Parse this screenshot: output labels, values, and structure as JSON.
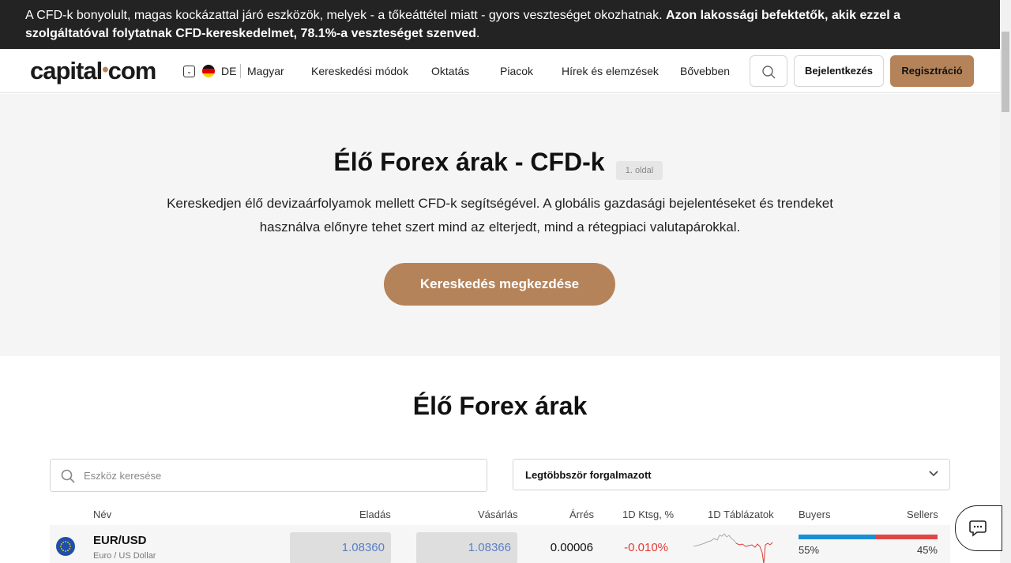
{
  "risk_warning": {
    "text": "A CFD-k bonyolult, magas kockázattal járó eszközök, melyek - a tőkeáttétel miatt - gyors veszteséget okozhatnak. ",
    "bold": "Azon lakossági befektetők, akik ezzel a szolgáltatóval folytatnak CFD-kereskedelmet, 78.1%-a veszteséget szenved",
    "end": "."
  },
  "header": {
    "logo_left": "capital",
    "logo_dot": "•",
    "logo_right": "com",
    "lang_code": "DE",
    "lang_name": "Magyar",
    "nav": [
      "Kereskedési módok",
      "Oktatás",
      "Piacok",
      "Hírek és elemzések",
      "Bővebben"
    ],
    "login": "Bejelentkezés",
    "register": "Regisztráció"
  },
  "hero": {
    "title": "Élő Forex árak - CFD-k",
    "badge": "1. oldal",
    "description": "Kereskedjen élő devizaárfolyamok mellett CFD-k segítségével. A globális gazdasági bejelentéseket és trendeket használva előnyre tehet szert mind az elterjedt, mind a rétegpiaci valutapárokkal.",
    "cta": "Kereskedés megkezdése"
  },
  "section": {
    "title": "Élő Forex árak"
  },
  "filters": {
    "search_placeholder": "Eszköz keresése",
    "sort_value": "Legtöbbször forgalmazott"
  },
  "table": {
    "headers": {
      "name": "Név",
      "sell": "Eladás",
      "buy": "Vásárlás",
      "spread": "Árrés",
      "change": "1D Ktsg, %",
      "chart": "1D Táblázatok",
      "buyers": "Buyers",
      "sellers": "Sellers"
    },
    "rows": [
      {
        "symbol": "EUR/USD",
        "name": "Euro / US Dollar",
        "sell": "1.08360",
        "buy": "1.08366",
        "spread": "0.00006",
        "change": "-0.010%",
        "buyers_pct": "55%",
        "sellers_pct": "45%",
        "buyers_value": 55,
        "sellers_value": 45
      }
    ]
  },
  "colors": {
    "accent": "#b5835a",
    "negative": "#e03b3b",
    "buyers": "#1b8fd6",
    "sellers": "#e04646"
  }
}
